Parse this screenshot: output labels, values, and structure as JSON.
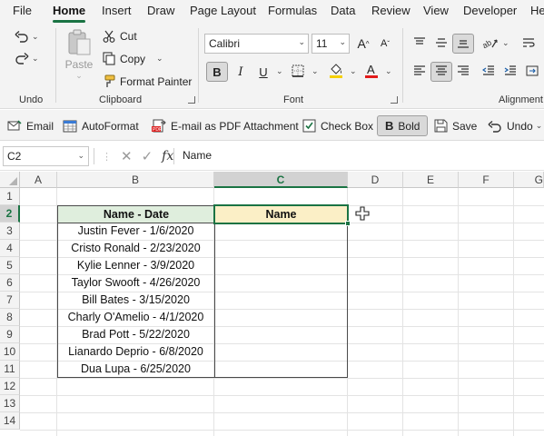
{
  "menu": {
    "tabs": [
      "File",
      "Home",
      "Insert",
      "Draw",
      "Page Layout",
      "Formulas",
      "Data",
      "Review",
      "View",
      "Developer",
      "He"
    ],
    "active": "Home"
  },
  "ribbon": {
    "undo": {
      "label": "Undo"
    },
    "clipboard": {
      "label": "Clipboard",
      "paste": "Paste",
      "cut": "Cut",
      "copy": "Copy",
      "format_painter": "Format Painter"
    },
    "font": {
      "label": "Font",
      "family": "Calibri",
      "size": "11",
      "bold": "B",
      "italic": "I",
      "underline": "U",
      "grow": "A",
      "shrink": "A"
    },
    "alignment": {
      "label": "Alignment"
    }
  },
  "quickbar": {
    "email": "Email",
    "autoformat": "AutoFormat",
    "email_pdf": "E-mail as PDF Attachment",
    "check_box": "Check Box",
    "bold": "Bold",
    "bold_glyph": "B",
    "save": "Save",
    "undo": "Undo"
  },
  "formula_bar": {
    "name_box": "C2",
    "fx": "fx",
    "value": "Name"
  },
  "sheet": {
    "columns": [
      "A",
      "B",
      "C",
      "D",
      "E",
      "F",
      "G"
    ],
    "rows": [
      "1",
      "2",
      "3",
      "4",
      "5",
      "6",
      "7",
      "8",
      "9",
      "10",
      "11",
      "12",
      "13",
      "14"
    ],
    "selected_cell": "C2",
    "table": {
      "header_b": "Name - Date",
      "header_c": "Name",
      "rows": [
        "Justin Fever - 1/6/2020",
        "Cristo Ronald - 2/23/2020",
        "Kylie Lenner - 3/9/2020",
        "Taylor Swooft - 4/26/2020",
        "Bill Bates - 3/15/2020",
        "Charly O'Amelio - 4/1/2020",
        "Brad Pott - 5/22/2020",
        "Lianardo Deprio - 6/8/2020",
        "Dua Lupa - 6/25/2020"
      ]
    }
  },
  "colors": {
    "accent": "#1a7343",
    "header_b_fill": "#dfeedd",
    "header_c_fill": "#fbefc6"
  }
}
